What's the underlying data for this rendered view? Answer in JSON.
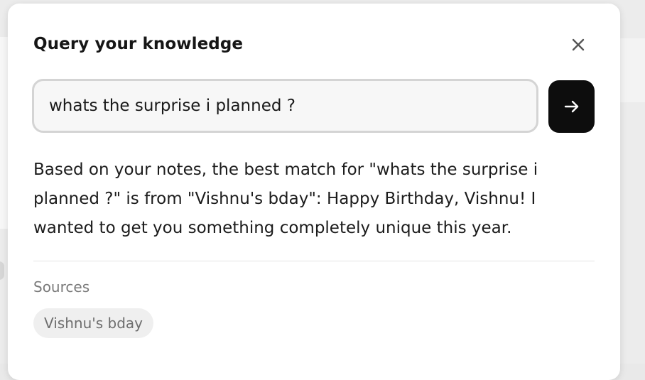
{
  "dialog": {
    "title": "Query your knowledge",
    "close_icon": "close-icon"
  },
  "query": {
    "value": "whats the surprise i planned ?",
    "submit_icon": "arrow-right-icon"
  },
  "answer": {
    "text": "Based on your notes, the best match for \"whats the surprise i planned ?\" is from \"Vishnu's bday\": Happy Birthday, Vishnu! I wanted to get you something completely unique this year."
  },
  "sources": {
    "label": "Sources",
    "items": [
      "Vishnu's bday"
    ]
  },
  "colors": {
    "submit_button": "#0d0d0d",
    "input_border": "#d4d4d4",
    "chip_background": "#efefef"
  }
}
